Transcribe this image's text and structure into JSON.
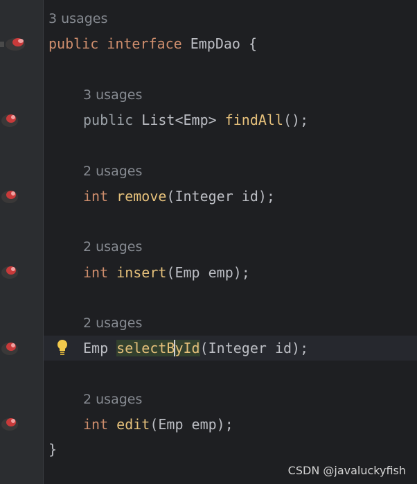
{
  "colors": {
    "keyword": "#cf8e6d",
    "method": "#56a8f5",
    "text": "#bcbec4",
    "usage": "#868a91",
    "background": "#1e1f22"
  },
  "lines": {
    "interface": {
      "usages": "3 usages",
      "modifier": "public",
      "keyword": "interface",
      "name": "EmpDao",
      "brace": "{"
    },
    "findAll": {
      "usages": "3 usages",
      "modifier": "public",
      "return_type": "List<Emp>",
      "name": "findAll",
      "params": "();"
    },
    "remove": {
      "usages": "2 usages",
      "return_type": "int",
      "name": "remove",
      "params": "(Integer id);"
    },
    "insert": {
      "usages": "2 usages",
      "return_type": "int",
      "name": "insert",
      "params": "(Emp emp);"
    },
    "selectById": {
      "usages": "2 usages",
      "return_type": "Emp",
      "name_before_caret": "selectB",
      "name_after_caret": "yId",
      "params": "(Integer id);"
    },
    "edit": {
      "usages": "2 usages",
      "return_type": "int",
      "name": "edit",
      "params": "(Emp emp);"
    },
    "closing_brace": "}"
  },
  "watermark": "CSDN @javaluckyfish",
  "icons": {
    "gutter": "implementation-marker-icon",
    "bulb": "lightbulb-icon"
  }
}
